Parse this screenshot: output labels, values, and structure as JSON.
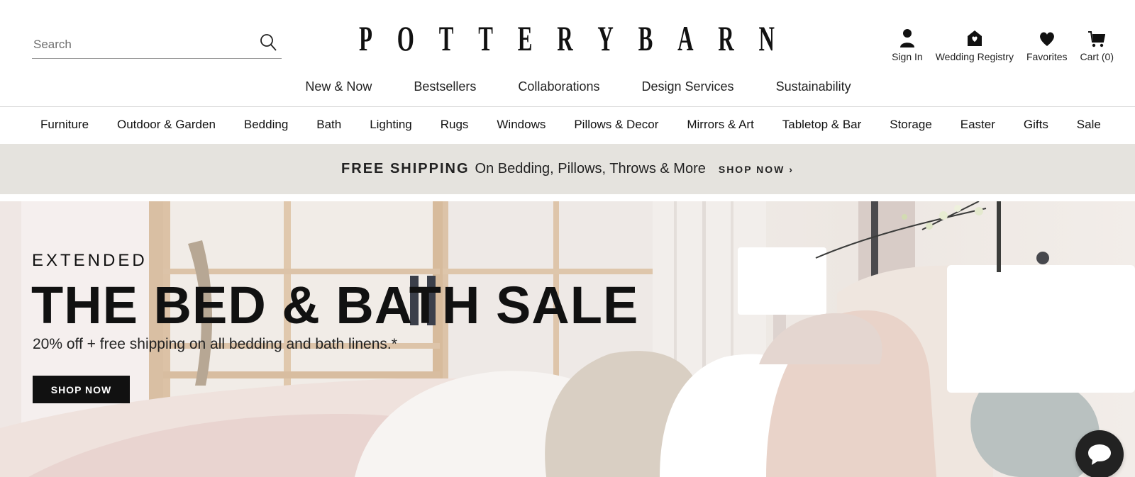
{
  "header": {
    "search_placeholder": "Search",
    "logo_letters": [
      "P",
      "O",
      "T",
      "T",
      "E",
      "R",
      "Y",
      "B",
      "A",
      "R",
      "N"
    ],
    "account": {
      "sign_in": "Sign In",
      "wedding_registry": "Wedding Registry",
      "favorites": "Favorites",
      "cart": "Cart",
      "cart_count": "(0)"
    }
  },
  "subnav": [
    "New & Now",
    "Bestsellers",
    "Collaborations",
    "Design Services",
    "Sustainability"
  ],
  "catnav": [
    "Furniture",
    "Outdoor & Garden",
    "Bedding",
    "Bath",
    "Lighting",
    "Rugs",
    "Windows",
    "Pillows & Decor",
    "Mirrors & Art",
    "Tabletop & Bar",
    "Storage",
    "Easter",
    "Gifts",
    "Sale"
  ],
  "promo": {
    "bold": "FREE SHIPPING",
    "text": "On Bedding, Pillows, Throws & More",
    "link": "SHOP NOW ›"
  },
  "hero": {
    "eyebrow": "EXTENDED",
    "headline": "THE BED & BATH SALE",
    "subtext": "20% off + free shipping on all bedding and bath linens.*",
    "button": "SHOP NOW"
  },
  "icons": {
    "search": "search-icon",
    "account": "person-icon",
    "registry": "house-heart-icon",
    "favorites": "heart-icon",
    "cart": "cart-icon",
    "chat": "chat-bubble-icon"
  }
}
